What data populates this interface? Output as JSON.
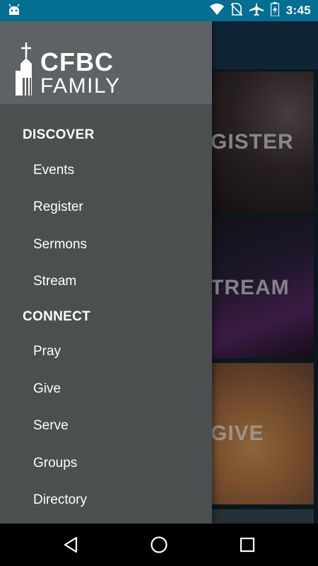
{
  "status_bar": {
    "time": "3:45",
    "icons": [
      "android-icon",
      "wifi-icon",
      "no-sim-icon",
      "airplane-icon",
      "battery-charging-icon"
    ]
  },
  "background_tiles": [
    {
      "label": "GISTER"
    },
    {
      "label": "TREAM"
    },
    {
      "label": "GIVE"
    }
  ],
  "drawer": {
    "logo": {
      "line1": "CFBC",
      "line2": "FAMILY"
    },
    "sections": [
      {
        "title": "DISCOVER",
        "items": [
          {
            "label": "Events"
          },
          {
            "label": "Register"
          },
          {
            "label": "Sermons"
          },
          {
            "label": "Stream"
          }
        ]
      },
      {
        "title": "CONNECT",
        "items": [
          {
            "label": "Pray"
          },
          {
            "label": "Give"
          },
          {
            "label": "Serve"
          },
          {
            "label": "Groups"
          },
          {
            "label": "Directory"
          }
        ]
      }
    ]
  },
  "nav_bar": {
    "buttons": [
      "back-icon",
      "home-icon",
      "recents-icon"
    ]
  },
  "colors": {
    "status_bar": "#046f92",
    "drawer_bg": "#4b4f50",
    "drawer_header": "#5e6264"
  }
}
